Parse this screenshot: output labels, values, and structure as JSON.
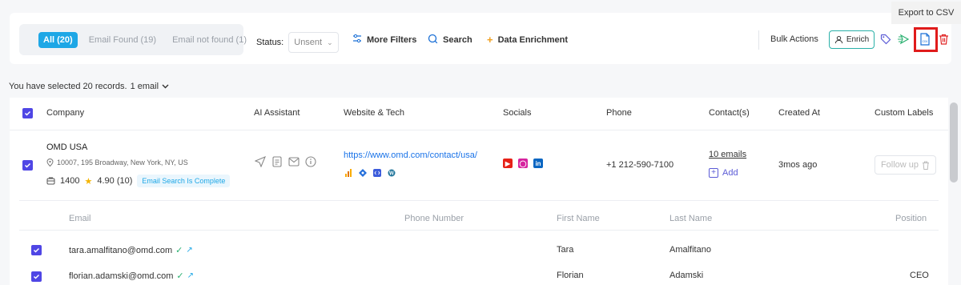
{
  "toolbar": {
    "tabs": [
      {
        "label": "All (20)",
        "active": true
      },
      {
        "label": "Email Found (19)",
        "active": false
      },
      {
        "label": "Email not found (1)",
        "active": false
      }
    ],
    "status_label": "Status:",
    "status_value": "Unsent",
    "more_filters": "More Filters",
    "search": "Search",
    "data_enrichment": "Data Enrichment",
    "bulk_actions": "Bulk Actions",
    "enrich": "Enrich",
    "tooltip": "Export to CSV"
  },
  "selection": {
    "text": "You have selected 20 records.",
    "dropdown": "1 email"
  },
  "table": {
    "columns": [
      "Company",
      "AI Assistant",
      "Website & Tech",
      "Socials",
      "Phone",
      "Contact(s)",
      "Created At",
      "Custom Labels"
    ],
    "row": {
      "company": "OMD USA",
      "address": "10007, 195 Broadway, New York, NY, US",
      "employees": "1400",
      "rating": "4.90 (10)",
      "badge": "Email Search Is Complete",
      "website": "https://www.omd.com/contact/usa/",
      "phone": "+1 212-590-7100",
      "contacts": "10 emails",
      "add": "Add",
      "created": "3mos ago",
      "label": "Follow up"
    }
  },
  "sub_table": {
    "columns": [
      "Email",
      "Phone Number",
      "First Name",
      "Last Name",
      "Position"
    ],
    "rows": [
      {
        "email": "tara.amalfitano@omd.com",
        "first": "Tara",
        "last": "Amalfitano",
        "position": ""
      },
      {
        "email": "florian.adamski@omd.com",
        "first": "Florian",
        "last": "Adamski",
        "position": "CEO"
      }
    ]
  },
  "colors": {
    "accent": "#1ea7e6",
    "checkbox": "#4f46e5",
    "highlight": "#e01b1b"
  }
}
